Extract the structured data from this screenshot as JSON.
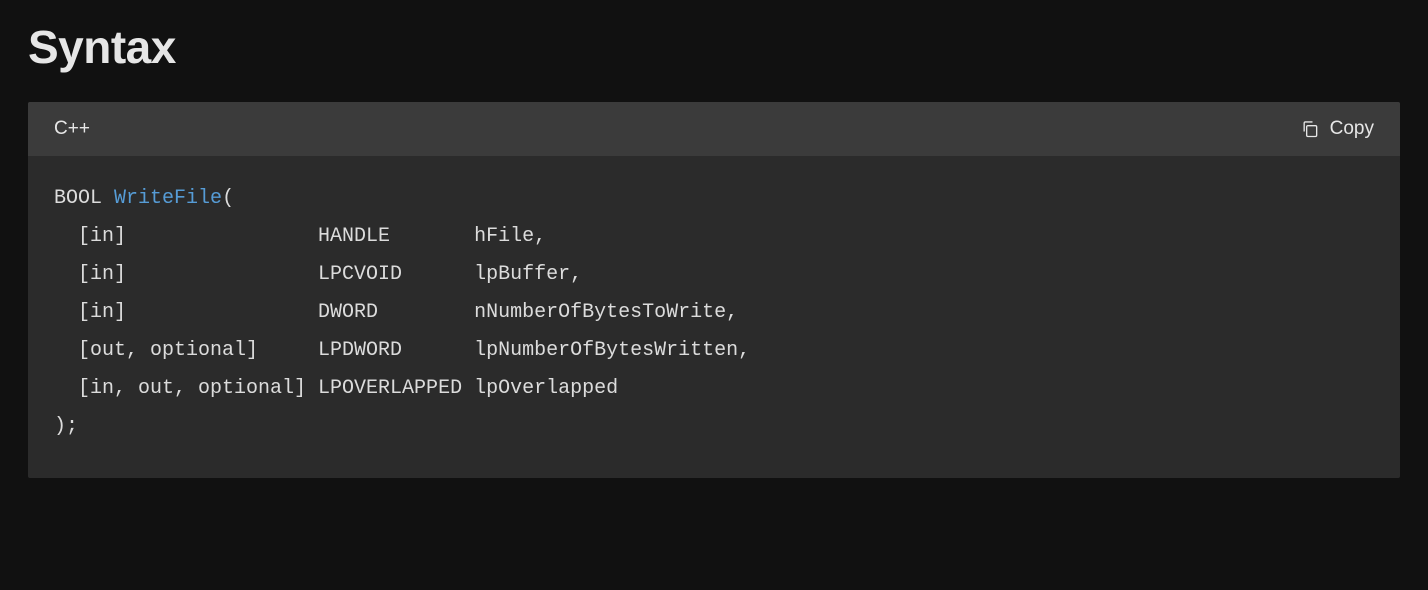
{
  "section": {
    "title": "Syntax"
  },
  "code": {
    "language": "C++",
    "copy_label": "Copy",
    "return_type": "BOOL",
    "function_name": "WriteFile",
    "open": "(",
    "params": [
      "  [in]                HANDLE       hFile,",
      "  [in]                LPCVOID      lpBuffer,",
      "  [in]                DWORD        nNumberOfBytesToWrite,",
      "  [out, optional]     LPDWORD      lpNumberOfBytesWritten,",
      "  [in, out, optional] LPOVERLAPPED lpOverlapped"
    ],
    "close": ");"
  }
}
